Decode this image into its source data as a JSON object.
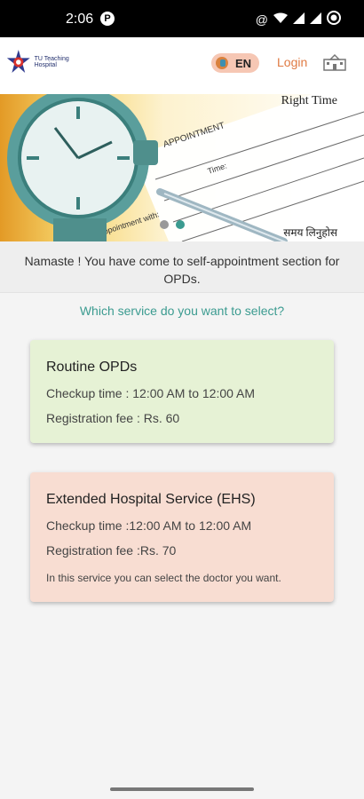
{
  "status_bar": {
    "time": "2:06",
    "badge": "P",
    "icons": [
      "at-icon",
      "wifi-icon",
      "signal-icon",
      "signal-icon",
      "battery-icon"
    ]
  },
  "header": {
    "logo_text": "TU Teaching Hospital",
    "language": "EN",
    "login_label": "Login",
    "hospital_icon": "hospital-icon"
  },
  "banner": {
    "title": "Right Time",
    "caption": "समय लिनुहोस",
    "slides": 2,
    "active_slide": 2
  },
  "intro_text": "Namaste ! You have come to self-appointment section for OPDs.",
  "question": "Which service do you want to select?",
  "services": [
    {
      "title": "Routine OPDs",
      "checkup_time": "Checkup time : 12:00 AM to 12:00 AM",
      "registration_fee": "Registration fee : Rs. 60",
      "color": "#e6f2d5"
    },
    {
      "title": "Extended Hospital Service (EHS)",
      "checkup_time": "Checkup time :12:00 AM to 12:00 AM",
      "registration_fee": "Registration fee :Rs. 70",
      "note": "In this service you can select the doctor you want.",
      "color": "#f8ddd2"
    }
  ],
  "colors": {
    "accent_teal": "#3b9b90",
    "login_orange": "#e07a43"
  }
}
